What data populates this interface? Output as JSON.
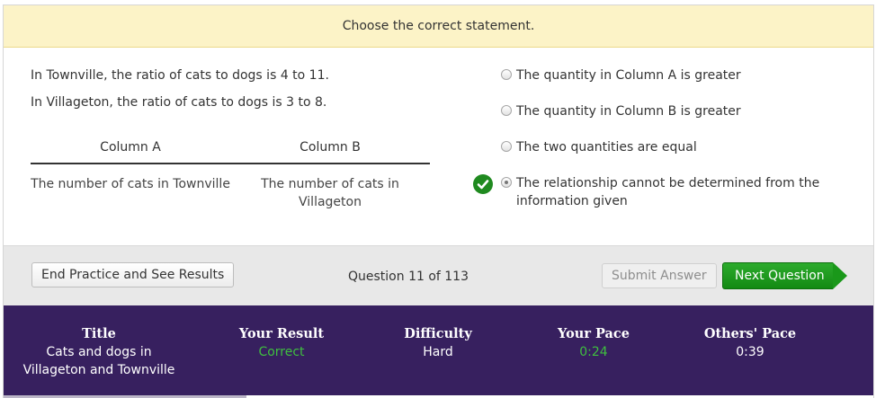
{
  "prompt": "Choose the correct statement.",
  "question": {
    "line1": "In Townville, the ratio of cats to dogs is 4 to 11.",
    "line2": "In Villageton, the ratio of cats to dogs is 3 to 8.",
    "column_a_header": "Column A",
    "column_b_header": "Column B",
    "column_a_value": "The number of cats in Townville",
    "column_b_value": "The number of cats in Villageton"
  },
  "options": [
    {
      "label": "The quantity in Column A is greater",
      "selected": false,
      "correct": false
    },
    {
      "label": "The quantity in Column B is greater",
      "selected": false,
      "correct": false
    },
    {
      "label": "The two quantities are equal",
      "selected": false,
      "correct": false
    },
    {
      "label": "The relationship cannot be determined from the information given",
      "selected": true,
      "correct": true
    }
  ],
  "toolbar": {
    "end_label": "End Practice and See Results",
    "question_counter": "Question 11 of 113",
    "submit_label": "Submit Answer",
    "next_label": "Next Question"
  },
  "results": {
    "title_header": "Title",
    "title_value": "Cats and dogs in Villageton and Townville",
    "result_header": "Your Result",
    "result_value": "Correct",
    "difficulty_header": "Difficulty",
    "difficulty_value": "Hard",
    "your_pace_header": "Your Pace",
    "your_pace_value": "0:24",
    "others_pace_header": "Others' Pace",
    "others_pace_value": "0:39"
  },
  "colors": {
    "prompt_bg": "#fcf3c7",
    "results_bg": "#37205f",
    "accent_green": "#1f8a1f",
    "status_green": "#3fbf3f"
  },
  "icons": {
    "check": "checkmark-icon",
    "arrow": "arrow-right-icon"
  }
}
